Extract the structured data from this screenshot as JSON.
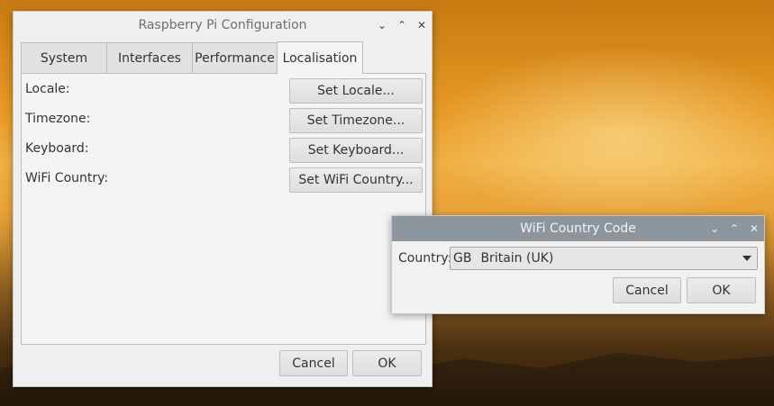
{
  "main_window": {
    "title": "Raspberry Pi Configuration",
    "tabs": [
      {
        "label": "System",
        "active": false
      },
      {
        "label": "Interfaces",
        "active": false
      },
      {
        "label": "Performance",
        "active": false
      },
      {
        "label": "Localisation",
        "active": true
      }
    ],
    "rows": [
      {
        "label": "Locale:",
        "button": "Set Locale..."
      },
      {
        "label": "Timezone:",
        "button": "Set Timezone..."
      },
      {
        "label": "Keyboard:",
        "button": "Set Keyboard..."
      },
      {
        "label": "WiFi Country:",
        "button": "Set WiFi Country..."
      }
    ],
    "cancel_label": "Cancel",
    "ok_label": "OK"
  },
  "wifi_dialog": {
    "title": "WiFi Country Code",
    "country_label": "Country:",
    "selected_code": "GB",
    "selected_name": "Britain (UK)",
    "cancel_label": "Cancel",
    "ok_label": "OK"
  },
  "icons": {
    "minimize": "chevron-down-icon",
    "maximize": "chevron-up-icon",
    "close": "close-icon",
    "dropdown": "triangle-down-icon"
  },
  "colors": {
    "window_bg": "#efefef",
    "dialog_titlebar": "#8e969d",
    "button_border": "#bdbdbd"
  }
}
